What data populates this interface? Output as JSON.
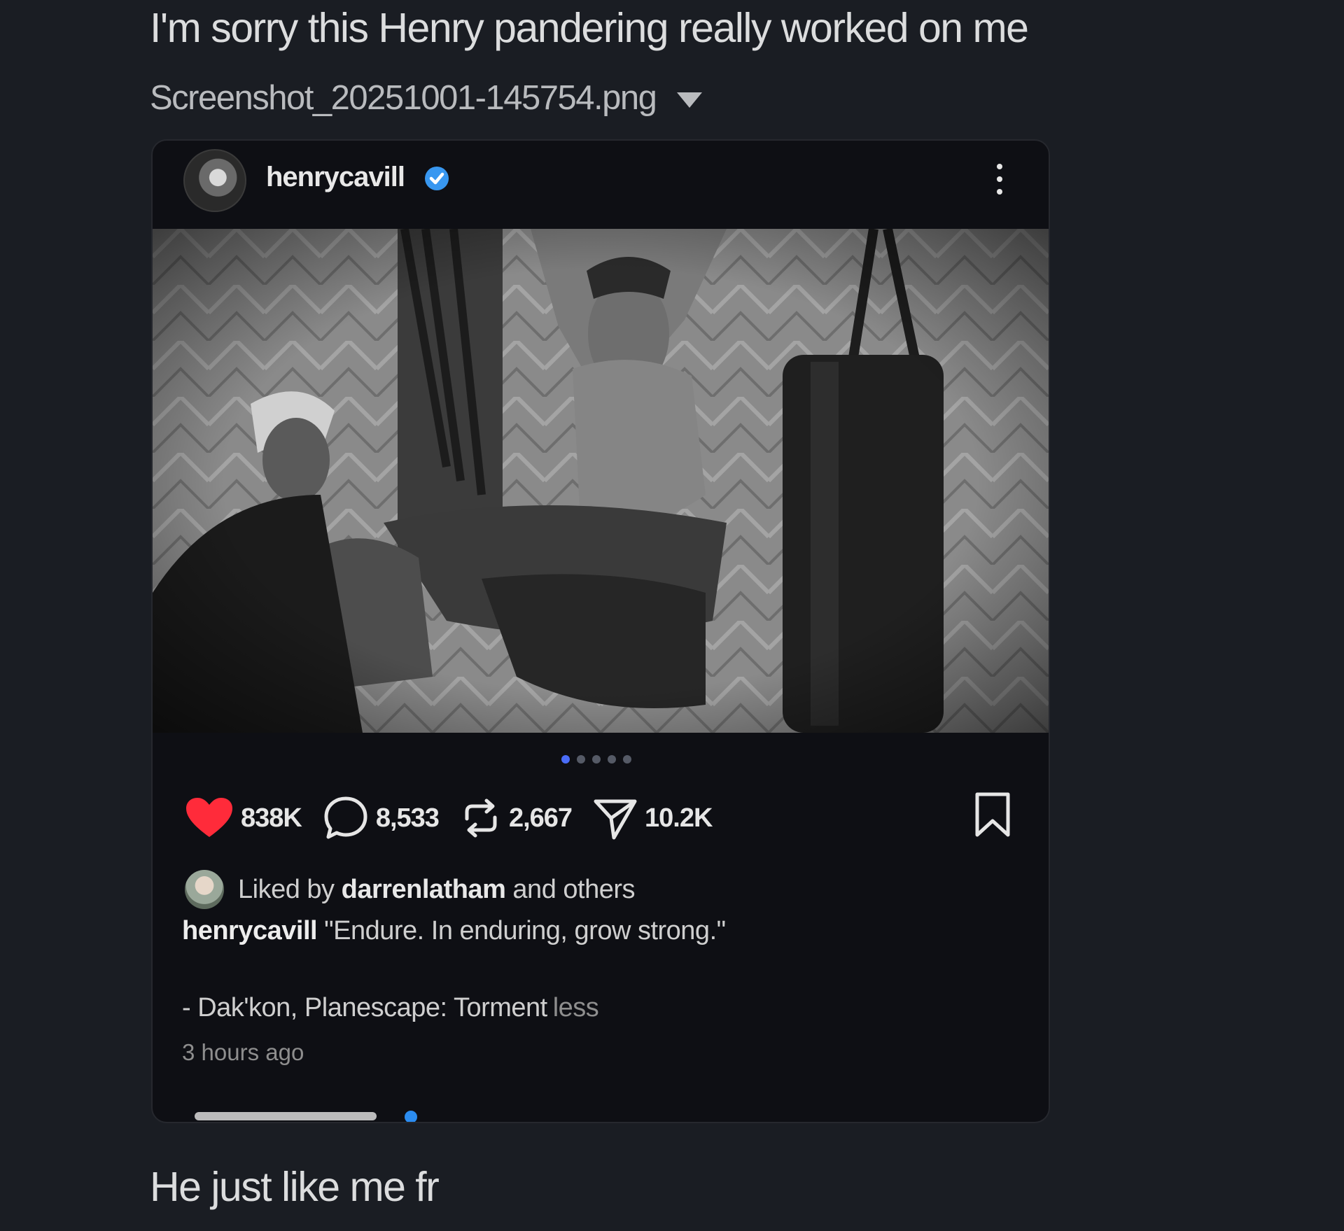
{
  "messages": {
    "first": "I'm sorry this Henry pandering really worked on me",
    "second": "He just like me fr"
  },
  "attachment": {
    "filename": "Screenshot_20251001-145754.png",
    "dropdown_icon": "caret-down-icon"
  },
  "post": {
    "username": "henrycavill",
    "verified_icon": "verified-badge-icon",
    "menu_icon": "more-vertical-icon",
    "carousel": {
      "count": 5,
      "active_index": 0
    },
    "stats": {
      "likes": "838K",
      "comments": "8,533",
      "reposts": "2,667",
      "shares": "10.2K"
    },
    "liked_by": {
      "prefix": "Liked by",
      "user": "darrenlatham",
      "suffix": "and others"
    },
    "caption": {
      "author": "henrycavill",
      "text": "\"Endure. In enduring, grow strong.\"",
      "line2": "- Dak'kon, Planescape: Torment",
      "less": "less"
    },
    "time": "3 hours ago"
  },
  "colors": {
    "background": "#1a1d23",
    "card": "#0e0f14",
    "heart": "#ff2b3a",
    "verified": "#3897f0",
    "active_dot": "#4a6cf7"
  }
}
